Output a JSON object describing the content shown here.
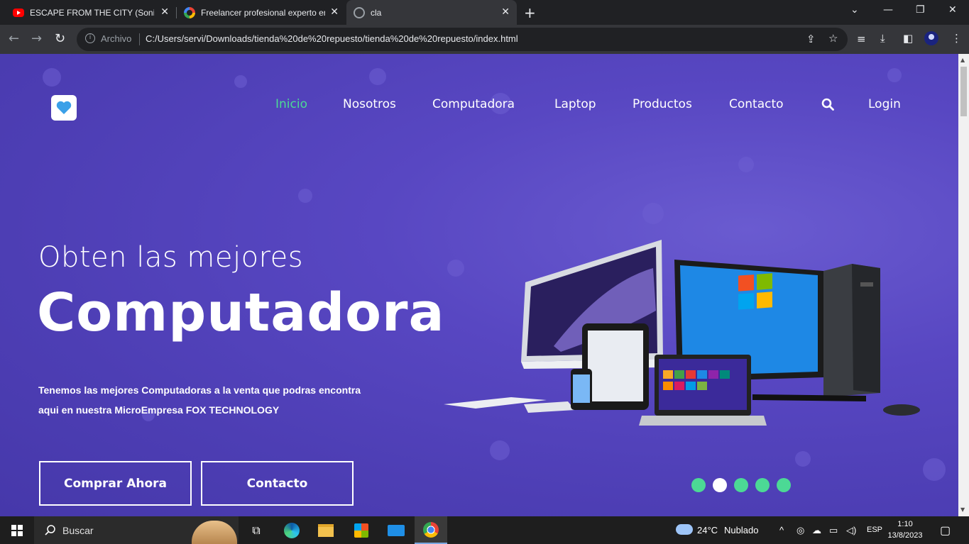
{
  "browser": {
    "tabs": [
      {
        "title": "ESCAPE FROM THE CITY (Sonic Ad",
        "icon": "youtube-icon",
        "active": false
      },
      {
        "title": "Freelancer profesional experto en",
        "icon": "chrome-ring-icon",
        "active": false
      },
      {
        "title": "cla",
        "icon": "globe-icon",
        "active": true
      }
    ],
    "address_scheme": "Archivo",
    "address_url": "C:/Users/servi/Downloads/tienda%20de%20repuesto/tienda%20de%20repuesto/index.html"
  },
  "page": {
    "nav": [
      {
        "label": "Inicio",
        "active": true
      },
      {
        "label": "Nosotros",
        "active": false
      },
      {
        "label": "Computadora",
        "active": false
      },
      {
        "label": "Laptop",
        "active": false
      },
      {
        "label": "Productos",
        "active": false
      },
      {
        "label": "Contacto",
        "active": false
      }
    ],
    "login_label": "Login",
    "hero": {
      "pre_title": "Obten las mejores",
      "title": "Computadora",
      "text_line1": "Tenemos las mejores Computadoras a la venta que podras encontra",
      "text_line2": "aqui en nuestra MicroEmpresa FOX TECHNOLOGY",
      "buy_label": "Comprar Ahora",
      "contact_label": "Contacto"
    },
    "slider": {
      "count": 5,
      "active_index": 1
    },
    "colors": {
      "accent": "#4cd995",
      "background": "#4d3eb4"
    }
  },
  "taskbar": {
    "search_placeholder": "Buscar",
    "weather_temp": "24°C",
    "weather_desc": "Nublado",
    "language": "ESP",
    "time": "1:10",
    "date": "13/8/2023"
  }
}
